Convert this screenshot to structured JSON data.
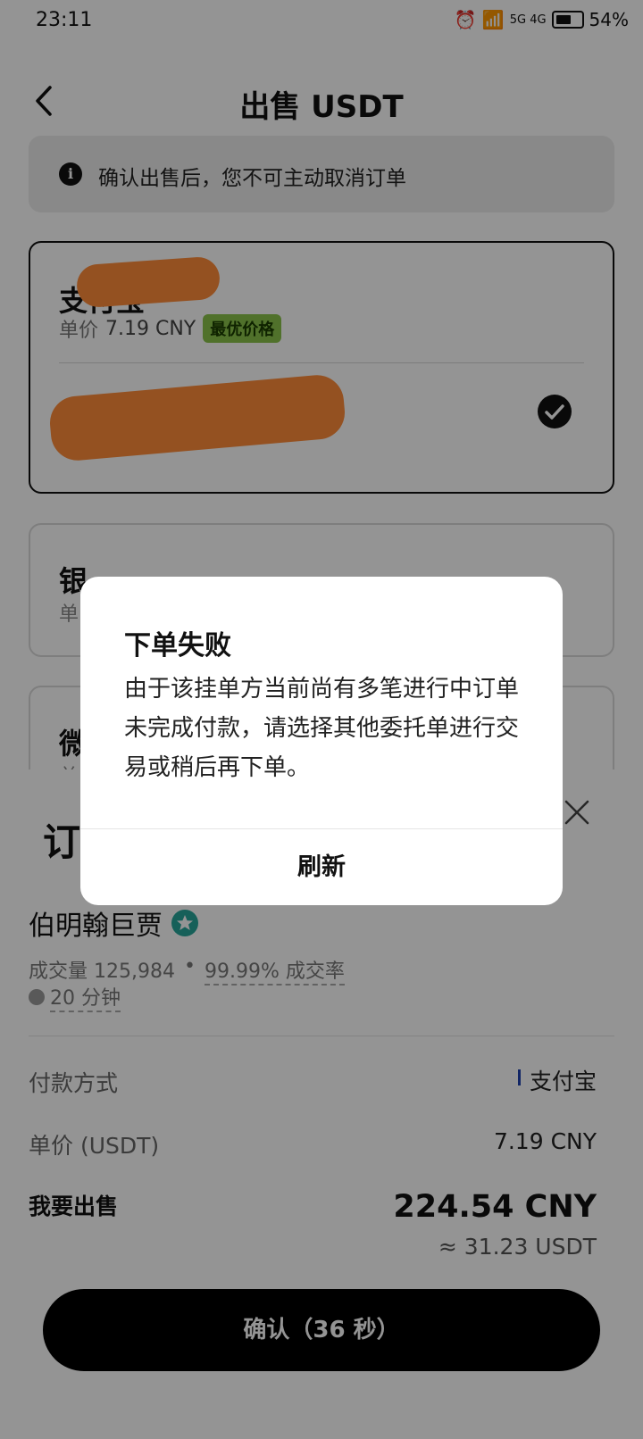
{
  "status_bar": {
    "time": "23:11",
    "signal": "5G 4G",
    "battery": "54%"
  },
  "header": {
    "title": "出售 USDT"
  },
  "notice": {
    "text": "确认出售后，您不可主动取消订单"
  },
  "payment_methods": [
    {
      "name": "支付宝",
      "price_label": "单价",
      "price_value": "7.19 CNY",
      "badge": "最优价格",
      "selected": true
    },
    {
      "name": "银",
      "sub": "单"
    },
    {
      "name": "微",
      "sub": "单"
    }
  ],
  "sheet": {
    "title": "订",
    "merchant": {
      "name": "伯明翰巨贾",
      "volume": "成交量 125,984",
      "separator": "•",
      "rate": "99.99% 成交率",
      "time": "20 分钟"
    },
    "rows": {
      "payment_label": "付款方式",
      "payment_value": "支付宝",
      "price_label": "单价 (USDT)",
      "price_value": "7.19 CNY",
      "sell_label": "我要出售",
      "sell_amount": "224.54 CNY",
      "sell_usdt": "≈ 31.23 USDT"
    },
    "confirm_button": "确认（36 秒）"
  },
  "dialog": {
    "title": "下单失败",
    "message": "由于该挂单方当前尚有多笔进行中订单未完成付款，请选择其他委托单进行交易或稍后再下单。",
    "button": "刷新"
  },
  "colors": {
    "accent_badge": "#8bc34a",
    "redaction": "#ff8c3a",
    "primary_button": "#000000",
    "overlay": "rgba(0,0,0,0.42)"
  }
}
